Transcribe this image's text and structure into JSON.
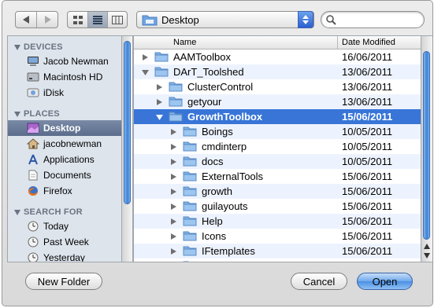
{
  "toolbar": {
    "location": "Desktop",
    "search_value": ""
  },
  "sidebar": {
    "devices_heading": "DEVICES",
    "places_heading": "PLACES",
    "search_heading": "SEARCH FOR",
    "devices": [
      {
        "label": "Jacob Newman",
        "icon": "computer-icon"
      },
      {
        "label": "Macintosh HD",
        "icon": "hard-drive-icon"
      },
      {
        "label": "iDisk",
        "icon": "idisk-icon"
      }
    ],
    "places": [
      {
        "label": "Desktop",
        "icon": "desktop-icon",
        "selected": true
      },
      {
        "label": "jacobnewman",
        "icon": "home-icon"
      },
      {
        "label": "Applications",
        "icon": "applications-icon"
      },
      {
        "label": "Documents",
        "icon": "documents-icon"
      },
      {
        "label": "Firefox",
        "icon": "firefox-icon"
      }
    ],
    "searches": [
      {
        "label": "Today",
        "icon": "clock-icon"
      },
      {
        "label": "Past Week",
        "icon": "clock-icon"
      },
      {
        "label": "Yesterday",
        "icon": "clock-icon"
      }
    ]
  },
  "file_list": {
    "col_name": "Name",
    "col_date": "Date Modified",
    "rows": [
      {
        "name": "AAMToolbox",
        "date": "16/06/2011",
        "level": 0,
        "expanded": false
      },
      {
        "name": "DArT_Toolshed",
        "date": "13/06/2011",
        "level": 0,
        "expanded": true
      },
      {
        "name": "ClusterControl",
        "date": "13/06/2011",
        "level": 1,
        "expanded": false
      },
      {
        "name": "getyour",
        "date": "13/06/2011",
        "level": 1,
        "expanded": false
      },
      {
        "name": "GrowthToolbox",
        "date": "15/06/2011",
        "level": 1,
        "expanded": true,
        "selected": true
      },
      {
        "name": "Boings",
        "date": "10/05/2011",
        "level": 2,
        "expanded": false
      },
      {
        "name": "cmdinterp",
        "date": "10/05/2011",
        "level": 2,
        "expanded": false
      },
      {
        "name": "docs",
        "date": "10/05/2011",
        "level": 2,
        "expanded": false
      },
      {
        "name": "ExternalTools",
        "date": "15/06/2011",
        "level": 2,
        "expanded": false
      },
      {
        "name": "growth",
        "date": "15/06/2011",
        "level": 2,
        "expanded": false
      },
      {
        "name": "guilayouts",
        "date": "15/06/2011",
        "level": 2,
        "expanded": false
      },
      {
        "name": "Help",
        "date": "15/06/2011",
        "level": 2,
        "expanded": false
      },
      {
        "name": "Icons",
        "date": "15/06/2011",
        "level": 2,
        "expanded": false
      },
      {
        "name": "IFtemplates",
        "date": "15/06/2011",
        "level": 2,
        "expanded": false
      },
      {
        "name": "",
        "date": "",
        "level": 2,
        "expanded": false
      }
    ]
  },
  "buttons": {
    "new_folder": "New Folder",
    "cancel": "Cancel",
    "open": "Open"
  },
  "colors": {
    "selection": "#3875d7",
    "sidebar_bg": "#dde4ec",
    "folder": "#7fb1e6"
  }
}
